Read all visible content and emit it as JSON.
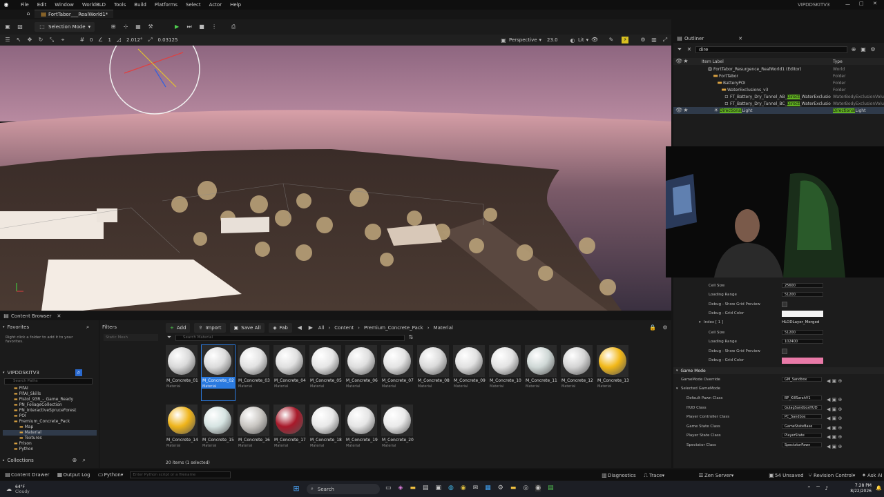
{
  "menubar": {
    "items": [
      "File",
      "Edit",
      "Window",
      "WorldBLD",
      "Tools",
      "Build",
      "Platforms",
      "Select",
      "Actor",
      "Help"
    ],
    "user": "VIPDDSKITV3"
  },
  "doc_tab": "FortTabor___RealWorld1*",
  "toolbar": {
    "mode": "Selection Mode"
  },
  "viewport_toolbar": {
    "vals": [
      "0",
      "1",
      "2.012°",
      "0.03125"
    ],
    "perspective": "Perspective",
    "fov": "23.0",
    "lit": "Lit"
  },
  "outliner": {
    "title": "Outliner",
    "search": "dire",
    "col_label": "Item Label",
    "col_type": "Type",
    "rows": [
      {
        "label": "FortTabor_Resurgence_RealWorld1 (Editor)",
        "type": "World"
      },
      {
        "label": "FortTabor",
        "type": "Folder"
      },
      {
        "label": "BatteryPOI",
        "type": "Folder"
      },
      {
        "label": "WaterExclusions_v3",
        "type": "Folder"
      },
      {
        "label_a": "FT_Battery_Dry_Tunnel_AB_",
        "label_hl": "Direct",
        "label_b": "_WaterExclusio",
        "type": "WaterBodyExclusionVolu"
      },
      {
        "label_a": "FT_Battery_Dry_Tunnel_BC_",
        "label_hl": "Direct",
        "label_b": "_WaterExclusio",
        "type": "WaterBodyExclusionVolu"
      },
      {
        "label_hl": "Directional",
        "label_b": "Light",
        "type_hl": "Directional",
        "type_b": "Light"
      }
    ]
  },
  "details": {
    "grid1": {
      "cell_size_label": "Cell Size",
      "cell_size": "25600",
      "loading_label": "Loading Range",
      "loading": "51200",
      "debug_preview": "Debug - Show Grid Preview",
      "debug_color": "Debug - Grid Color"
    },
    "index_label": "Index [ 1 ]",
    "index_value": "HLODLayer_Merged",
    "grid2": {
      "cell_size_label": "Cell Size",
      "cell_size": "51200",
      "loading_label": "Loading Range",
      "loading": "102400",
      "debug_preview": "Debug - Show Grid Preview",
      "debug_color": "Debug - Grid Color"
    },
    "game_mode_header": "Game Mode",
    "gamemode_override_label": "GameMode Override",
    "gamemode_override": "GM_Sandbox",
    "selected_gamemode": "Selected GameMode",
    "classes": [
      {
        "label": "Default Pawn Class",
        "value": "BP_KillSarahV1"
      },
      {
        "label": "HUD Class",
        "value": "GulagSandboxHUD"
      },
      {
        "label": "Player Controller Class",
        "value": "PC_Sandbox"
      },
      {
        "label": "Game State Class",
        "value": "GameStateBase"
      },
      {
        "label": "Player State Class",
        "value": "PlayerState"
      },
      {
        "label": "Spectator Class",
        "value": "SpectatorPawn"
      }
    ],
    "colors": {
      "grid1": "#f4f4f4",
      "grid2": "#e97aa8"
    }
  },
  "content_browser": {
    "tab": "Content Browser",
    "favorites": "Favorites",
    "favorites_hint": "Right click a folder to add it to your favorites.",
    "project": "VIPDDSKITV3",
    "search_paths": "Search Paths",
    "folders": [
      "PifAI",
      "PifAI_Skills",
      "Pistol_93R_-_Game_Ready",
      "PN_FoliageCollection",
      "PN_InteractiveSpruceForest",
      "POI",
      "Premium_Concrete_Pack",
      "Map",
      "Material",
      "Textures",
      "Prison",
      "Python"
    ],
    "collections": "Collections",
    "filters": "Filters",
    "filter_chip": "Static Mesh",
    "add": "Add",
    "import": "Import",
    "save_all": "Save All",
    "fab": "Fab",
    "breadcrumb": [
      "All",
      "Content",
      "Premium_Concrete_Pack",
      "Material"
    ],
    "search_placeholder": "Search Material",
    "items_count": "20 items (1 selected)",
    "asset_type": "Material",
    "assets": [
      {
        "name": "M_Concrete_01",
        "color": "#d9d9d9"
      },
      {
        "name": "M_Concrete_02",
        "color": "#dcdcdc"
      },
      {
        "name": "M_Concrete_03",
        "color": "#e2e2e2"
      },
      {
        "name": "M_Concrete_04",
        "color": "#e0e0e0"
      },
      {
        "name": "M_Concrete_05",
        "color": "#e6e6e6"
      },
      {
        "name": "M_Concrete_06",
        "color": "#dedede"
      },
      {
        "name": "M_Concrete_07",
        "color": "#e4e4e4"
      },
      {
        "name": "M_Concrete_08",
        "color": "#dadada"
      },
      {
        "name": "M_Concrete_09",
        "color": "#e1e1e1"
      },
      {
        "name": "M_Concrete_10",
        "color": "#e3e3e3"
      },
      {
        "name": "M_Concrete_11",
        "color": "#cfd8d6"
      },
      {
        "name": "M_Concrete_12",
        "color": "#d4d4d4"
      },
      {
        "name": "M_Concrete_13",
        "color": "#f2b818"
      },
      {
        "name": "M_Concrete_14",
        "color": "#efb41a"
      },
      {
        "name": "M_Concrete_15",
        "color": "#d6e4e2"
      },
      {
        "name": "M_Concrete_16",
        "color": "#c9c6c2"
      },
      {
        "name": "M_Concrete_17",
        "color": "#a8192a"
      },
      {
        "name": "M_Concrete_18",
        "color": "#e8e8e8"
      },
      {
        "name": "M_Concrete_19",
        "color": "#e5e5e5"
      },
      {
        "name": "M_Concrete_20",
        "color": "#eaeaea"
      }
    ]
  },
  "statusbar": {
    "content_drawer": "Content Drawer",
    "output_log": "Output Log",
    "python": "Python",
    "cmd_placeholder": "Enter Python script or a filename",
    "diagnostics": "Diagnostics",
    "trace": "Trace",
    "zen": "Zen Server",
    "unsaved": "54 Unsaved",
    "revision": "Revision Control",
    "ask": "Ask AI"
  },
  "taskbar": {
    "temp": "64°F",
    "weather": "Cloudy",
    "search": "Search",
    "time": "7:28 PM",
    "date": "8/22/2026"
  }
}
